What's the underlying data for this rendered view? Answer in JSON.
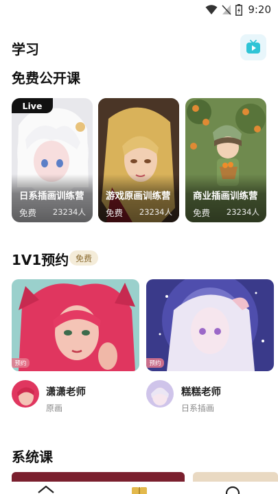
{
  "status_bar": {
    "time": "9:20"
  },
  "header": {
    "title": "学习"
  },
  "free_section": {
    "title": "免费公开课",
    "courses": [
      {
        "name": "日系插画训练营",
        "price": "免费",
        "count": "23234人",
        "live": "Live"
      },
      {
        "name": "游戏原画训练营",
        "price": "免费",
        "count": "23234人"
      },
      {
        "name": "商业插画训练营",
        "price": "免费",
        "count": "23234人"
      }
    ]
  },
  "v1_section": {
    "title": "1V1预约",
    "badge": "免费",
    "teachers": [
      {
        "tag": "预约",
        "name": "潇潇老师",
        "style": "原画"
      },
      {
        "tag": "预约",
        "name": "糕糕老师",
        "style": "日系插画"
      }
    ]
  },
  "system_section": {
    "title": "系统课"
  },
  "icons": {
    "wifi": "wifi-icon",
    "signal": "signal-off-icon",
    "battery": "battery-icon",
    "tv": "tv-play-icon",
    "home": "home-icon",
    "book": "book-icon",
    "search": "search-icon"
  },
  "colors": {
    "accent": "#2ec4d6",
    "badge_bg": "#f4ecd9",
    "reserve_tag": "#e4788c"
  }
}
